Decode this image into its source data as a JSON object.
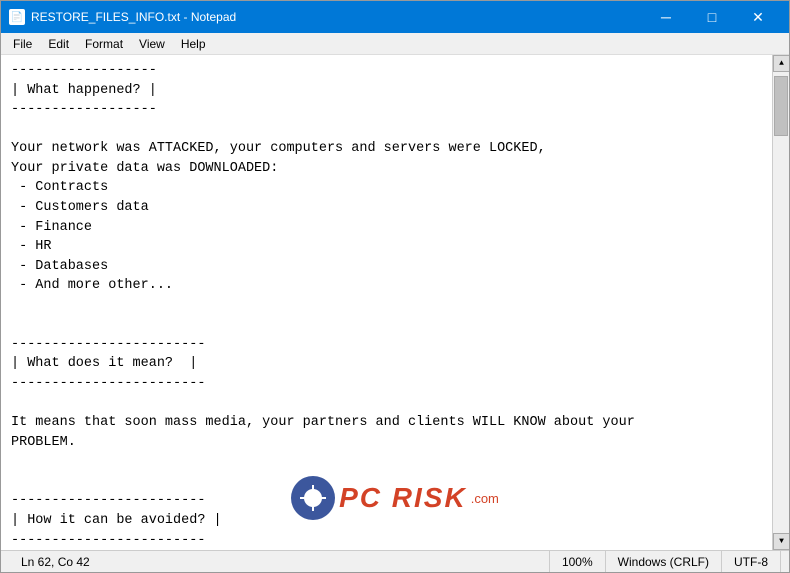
{
  "window": {
    "title": "RESTORE_FILES_INFO.txt - Notepad",
    "icon_label": "N"
  },
  "title_bar": {
    "minimize_label": "─",
    "maximize_label": "□",
    "close_label": "✕"
  },
  "menu": {
    "items": [
      "File",
      "Edit",
      "Format",
      "View",
      "Help"
    ]
  },
  "content": {
    "text": "------------------\n| What happened? |\n------------------\n\nYour network was ATTACKED, your computers and servers were LOCKED,\nYour private data was DOWNLOADED:\n - Contracts\n - Customers data\n - Finance\n - HR\n - Databases\n - And more other...\n\n\n------------------------\n| What does it mean?  |\n------------------------\n\nIt means that soon mass media, your partners and clients WILL KNOW about your\nPROBLEM.\n\n\n------------------------\n| How it can be avoided? |\n------------------------"
  },
  "status_bar": {
    "position": "Ln 62, Co 42",
    "zoom": "100%",
    "line_ending": "Windows (CRLF)",
    "encoding": "UTF-8"
  },
  "watermark": {
    "text": "PC RISK",
    "domain": ".com"
  }
}
